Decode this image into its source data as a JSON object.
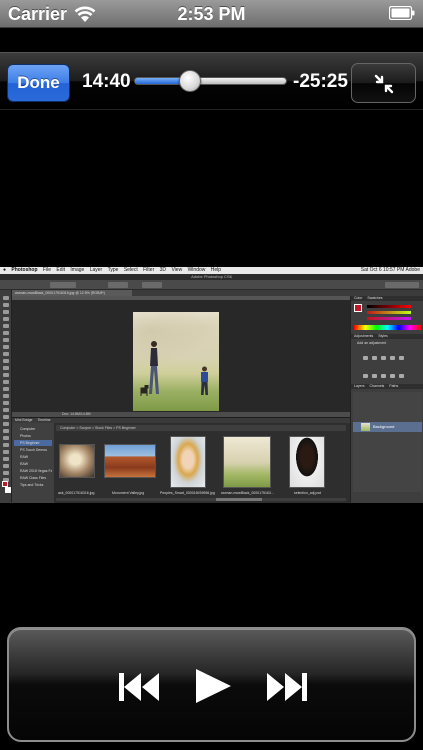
{
  "status_bar": {
    "carrier": "Carrier",
    "time": "2:53 PM",
    "wifi_icon": "wifi-icon",
    "battery_icon": "battery-icon"
  },
  "playback_bar": {
    "done_label": "Done",
    "elapsed": "14:40",
    "remaining": "-25:25",
    "progress_fraction": 0.366,
    "fullscreen_icon": "exit-fullscreen-icon",
    "accent_color": "#2f6fe0"
  },
  "video": {
    "menubar": {
      "app": "Photoshop",
      "items": [
        "File",
        "Edit",
        "Image",
        "Layer",
        "Type",
        "Select",
        "Filter",
        "3D",
        "View",
        "Window",
        "Help"
      ],
      "clock": "Sat Oct 6 10:57 PM",
      "user": "Adobe"
    },
    "window_title": "Adobe Photoshop CS6",
    "document_tab": "woman-mowBlack_000017516316.jpg @ 12.5% (RGB/8*)",
    "status_zoom": "Doc: 14.8M/14.8M",
    "right_panel_tabs": [
      "Color",
      "Swatches"
    ],
    "adjustments_tabs": [
      "Adjustments",
      "Styles"
    ],
    "adjustments_hint": "Add an adjustment",
    "layers_tabs": [
      "Layers",
      "Channels",
      "Paths"
    ],
    "layer_name": "Background",
    "bridge_tabs": [
      "Mini Bridge",
      "Timeline"
    ],
    "bridge_path": "Computer > Scoyne > Stock Files > PS Beginner",
    "bridge_folders": [
      "Computer",
      "Photos",
      "PS Beginner",
      "PS Touch Demos",
      "RAW",
      "RAW",
      "RAW 2018 Vegas Fa",
      "RAW Class Files",
      "Tips and Tricks"
    ],
    "thumbnails": [
      {
        "caption": "ask_000017516316.jpg"
      },
      {
        "caption": "Monument Valley.jpg"
      },
      {
        "caption": "Peoples_Smart_000016939956.jpg"
      },
      {
        "caption": "woman-mowBlack_0000175163..."
      },
      {
        "caption": "selection_adj.psd"
      }
    ]
  },
  "controls": {
    "previous_icon": "skip-previous-icon",
    "play_icon": "play-icon",
    "next_icon": "skip-next-icon"
  }
}
